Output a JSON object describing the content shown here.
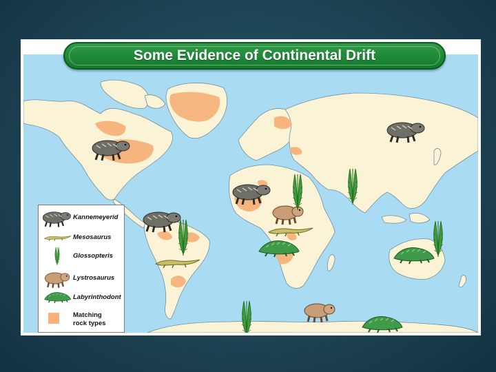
{
  "title": "Some Evidence of Continental Drift",
  "colors": {
    "ocean": "#a9dcf3",
    "land": "#fbf3d6",
    "matching_rock": "#f6b27a",
    "banner": "#1f8a3a",
    "glossopteris": "#3c9a3a",
    "labyrinthodont": "#2e8a3c",
    "mesosaurus": "#b7b04a",
    "kannemeyerid": "#6b6b64",
    "lystrosaurus": "#c9a27a"
  },
  "legend": {
    "items": [
      {
        "label": "Kannemeyerid",
        "icon": "kannemeyerid-icon"
      },
      {
        "label": "Mesosaurus",
        "icon": "mesosaurus-icon"
      },
      {
        "label": "Glossopteris",
        "icon": "glossopteris-icon"
      },
      {
        "label": "Lystrosaurus",
        "icon": "lystrosaurus-icon"
      },
      {
        "label": "Labyrinthodont",
        "icon": "labyrinthodont-icon"
      },
      {
        "label": "Matching\nrock types",
        "icon": "matching-rock-swatch"
      }
    ]
  }
}
